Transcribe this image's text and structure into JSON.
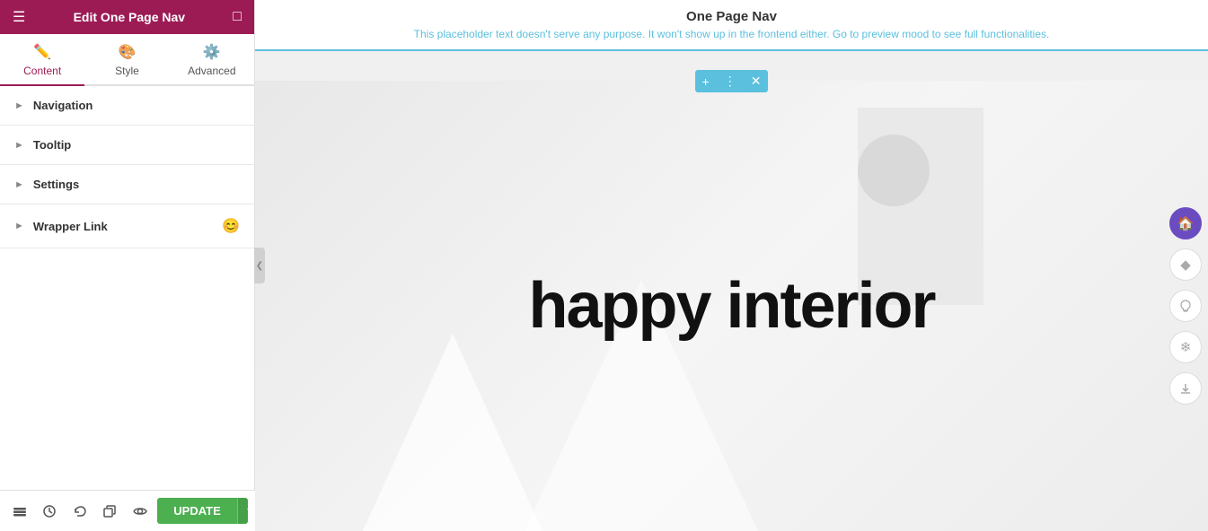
{
  "header": {
    "title": "Edit One Page Nav",
    "menu_icon": "☰",
    "grid_icon": "⊞"
  },
  "tabs": [
    {
      "id": "content",
      "label": "Content",
      "icon": "✏️",
      "active": true
    },
    {
      "id": "style",
      "label": "Style",
      "icon": "🎨",
      "active": false
    },
    {
      "id": "advanced",
      "label": "Advanced",
      "icon": "⚙️",
      "active": false
    }
  ],
  "accordion": [
    {
      "id": "navigation",
      "label": "Navigation",
      "has_emoji": false
    },
    {
      "id": "tooltip",
      "label": "Tooltip",
      "has_emoji": false
    },
    {
      "id": "settings",
      "label": "Settings",
      "has_emoji": false
    },
    {
      "id": "wrapper_link",
      "label": "Wrapper Link",
      "has_emoji": true,
      "emoji": "😊"
    }
  ],
  "main": {
    "widget_title": "One Page Nav",
    "placeholder_text": "This placeholder text doesn't serve any purpose. It won't show up in the frontend either. Go to preview mood to see full functionalities.",
    "hero_text": "happy interior",
    "widget_toolbar_buttons": [
      "+",
      "⠿",
      "×"
    ]
  },
  "right_nav": [
    {
      "id": "home",
      "icon": "🏠",
      "active": true
    },
    {
      "id": "diamond",
      "icon": "💎",
      "active": false
    },
    {
      "id": "bulb",
      "icon": "💡",
      "active": false
    },
    {
      "id": "snowflake",
      "icon": "❄️",
      "active": false
    },
    {
      "id": "download",
      "icon": "⬇️",
      "active": false
    }
  ],
  "bottom_toolbar": {
    "update_label": "UPDATE",
    "icons": [
      "layers",
      "history",
      "undo",
      "duplicate",
      "eye"
    ]
  },
  "colors": {
    "header_bg": "#9c1b55",
    "active_tab": "#9c1b55",
    "update_btn": "#4CAF50",
    "right_nav_active": "#6b4cc0",
    "placeholder_color": "#5bc0de",
    "border_accent": "#5bc0de"
  }
}
